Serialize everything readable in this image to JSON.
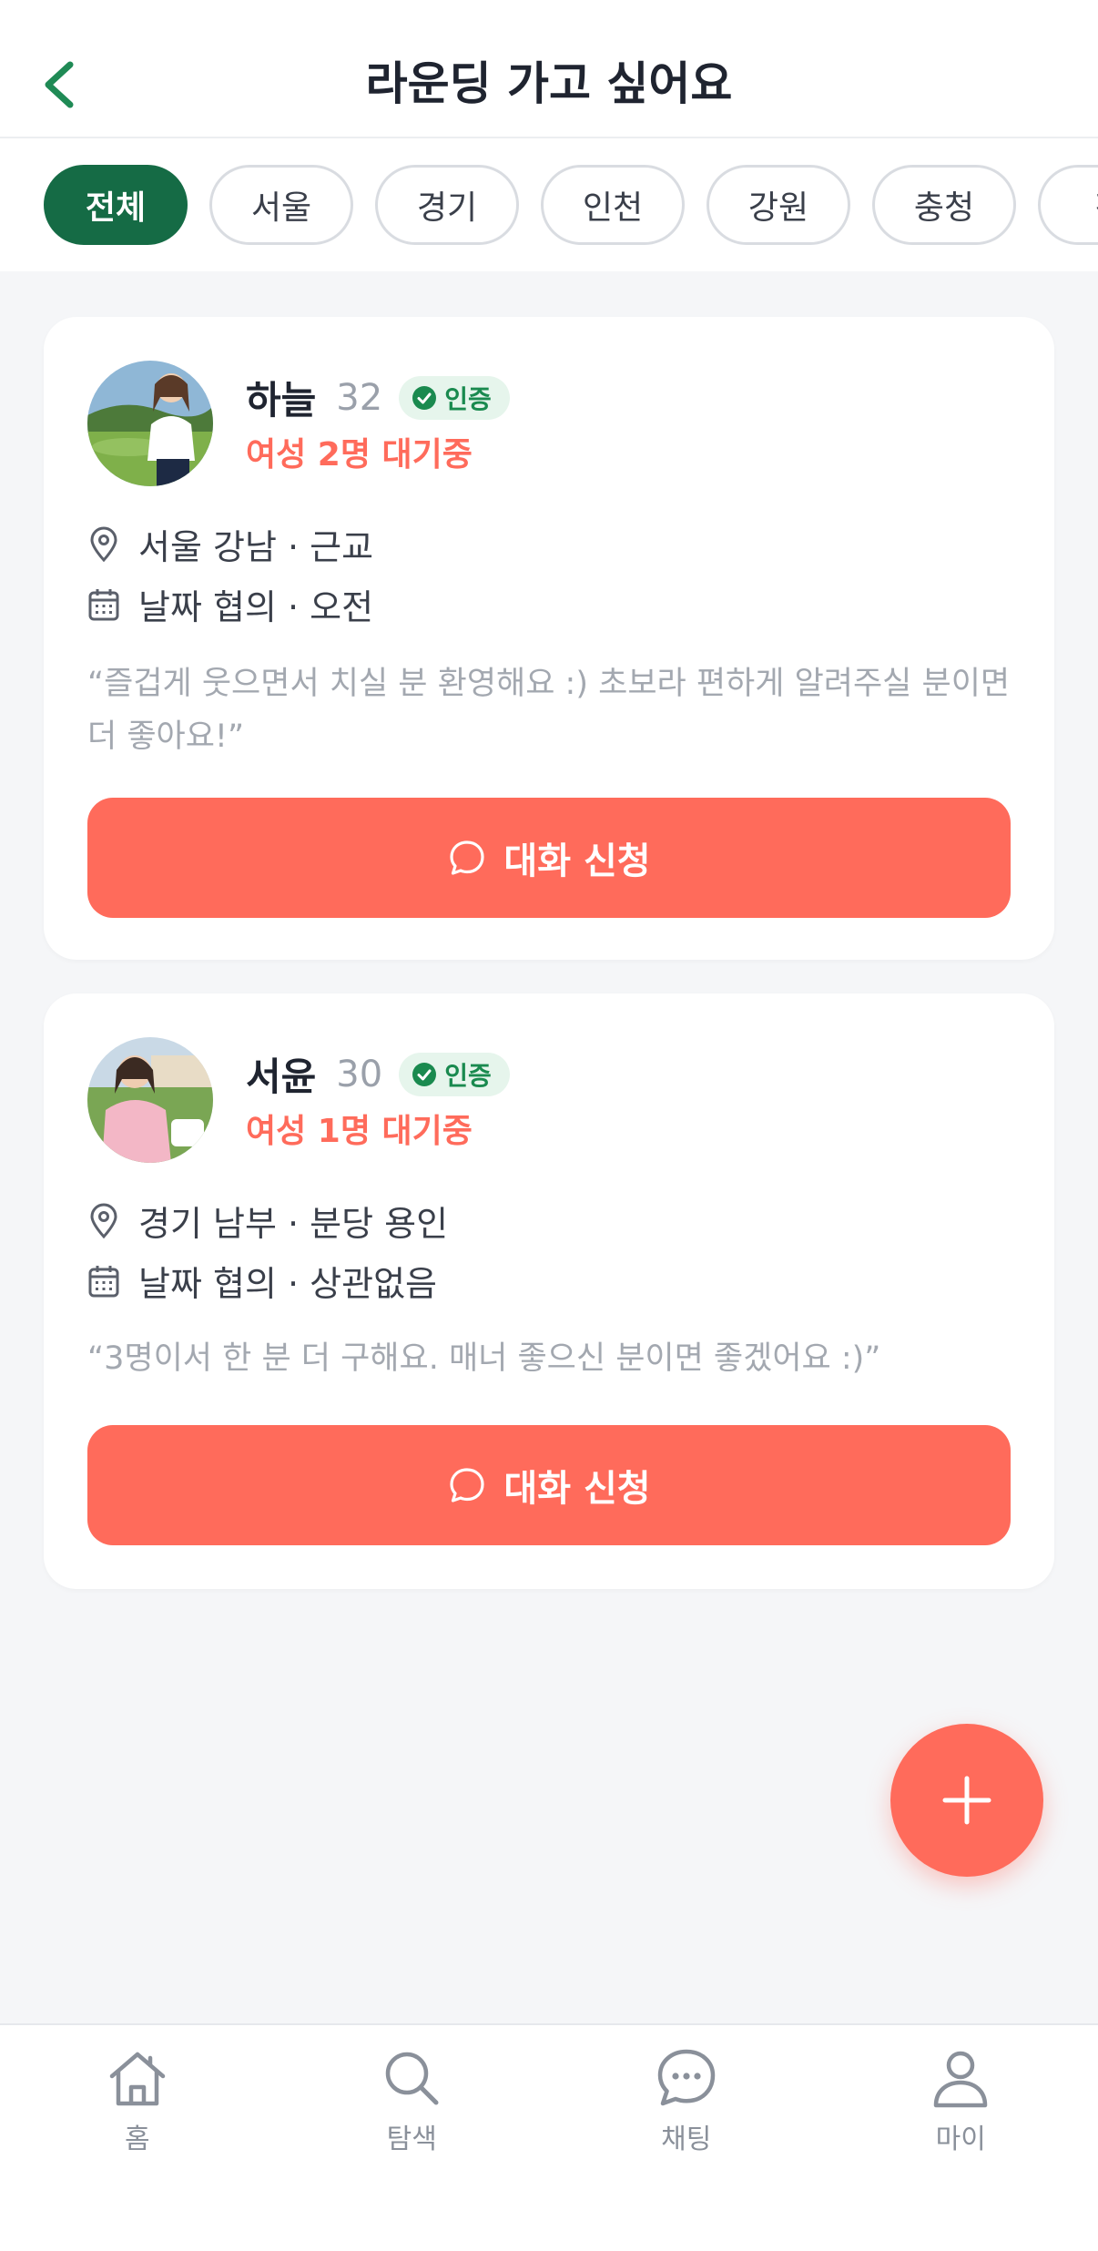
{
  "header": {
    "title": "라운딩 가고 싶어요",
    "back_icon": "chevron-left-icon"
  },
  "filters": [
    {
      "label": "전체",
      "active": true
    },
    {
      "label": "서울",
      "active": false
    },
    {
      "label": "경기",
      "active": false
    },
    {
      "label": "인천",
      "active": false
    },
    {
      "label": "강원",
      "active": false
    },
    {
      "label": "충청",
      "active": false
    },
    {
      "label": "전",
      "active": false
    }
  ],
  "posts": [
    {
      "name": "하늘",
      "age": "32",
      "verified_label": "인증",
      "waiting": "여성 2명 대기중",
      "location": "서울 강남 · 근교",
      "schedule": "날짜 협의 · 오전",
      "memo": "“즐겁게 웃으면서 치실 분 환영해요 :) 초보라 편하게 알려주실 분이면 더 좋아요!”",
      "button_label": "대화 신청"
    },
    {
      "name": "서윤",
      "age": "30",
      "verified_label": "인증",
      "waiting": "여성 1명 대기중",
      "location": "경기 남부 · 분당 용인",
      "schedule": "날짜 협의 · 상관없음",
      "memo": "“3명이서 한 분 더 구해요. 매너 좋으신 분이면 좋겠어요 :)”",
      "button_label": "대화 신청"
    }
  ],
  "fab": {
    "icon": "plus-icon"
  },
  "bottom_nav": [
    {
      "label": "홈",
      "icon": "home-icon"
    },
    {
      "label": "탐색",
      "icon": "search-icon"
    },
    {
      "label": "채팅",
      "icon": "chat-icon"
    },
    {
      "label": "마이",
      "icon": "person-icon"
    }
  ],
  "colors": {
    "primary_green": "#156b45",
    "accent_coral": "#ff6b5b",
    "verified_green": "#1a8a4f",
    "background": "#f5f6f8"
  }
}
